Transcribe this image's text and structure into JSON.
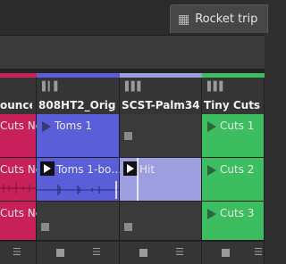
{
  "tabs": {
    "active_label": "Rocket trip"
  },
  "colors": {
    "pink": "#c8205a",
    "blue": "#5a5ed8",
    "lavender": "#9d9ee0",
    "green": "#3cbe60"
  },
  "tracks": [
    {
      "name": "ounce",
      "clips": [
        "Cuts Ne…",
        "Cuts Ne…",
        "Cuts Ne…"
      ]
    },
    {
      "name": "808HT2_Orig",
      "clips": [
        "Toms 1",
        "Toms 1-bo…"
      ]
    },
    {
      "name": "SCST-Palm34…",
      "clips": [
        "Hit"
      ]
    },
    {
      "name": "Tiny Cuts",
      "clips": [
        "Cuts 1",
        "Cuts 2",
        "Cuts 3"
      ]
    }
  ]
}
